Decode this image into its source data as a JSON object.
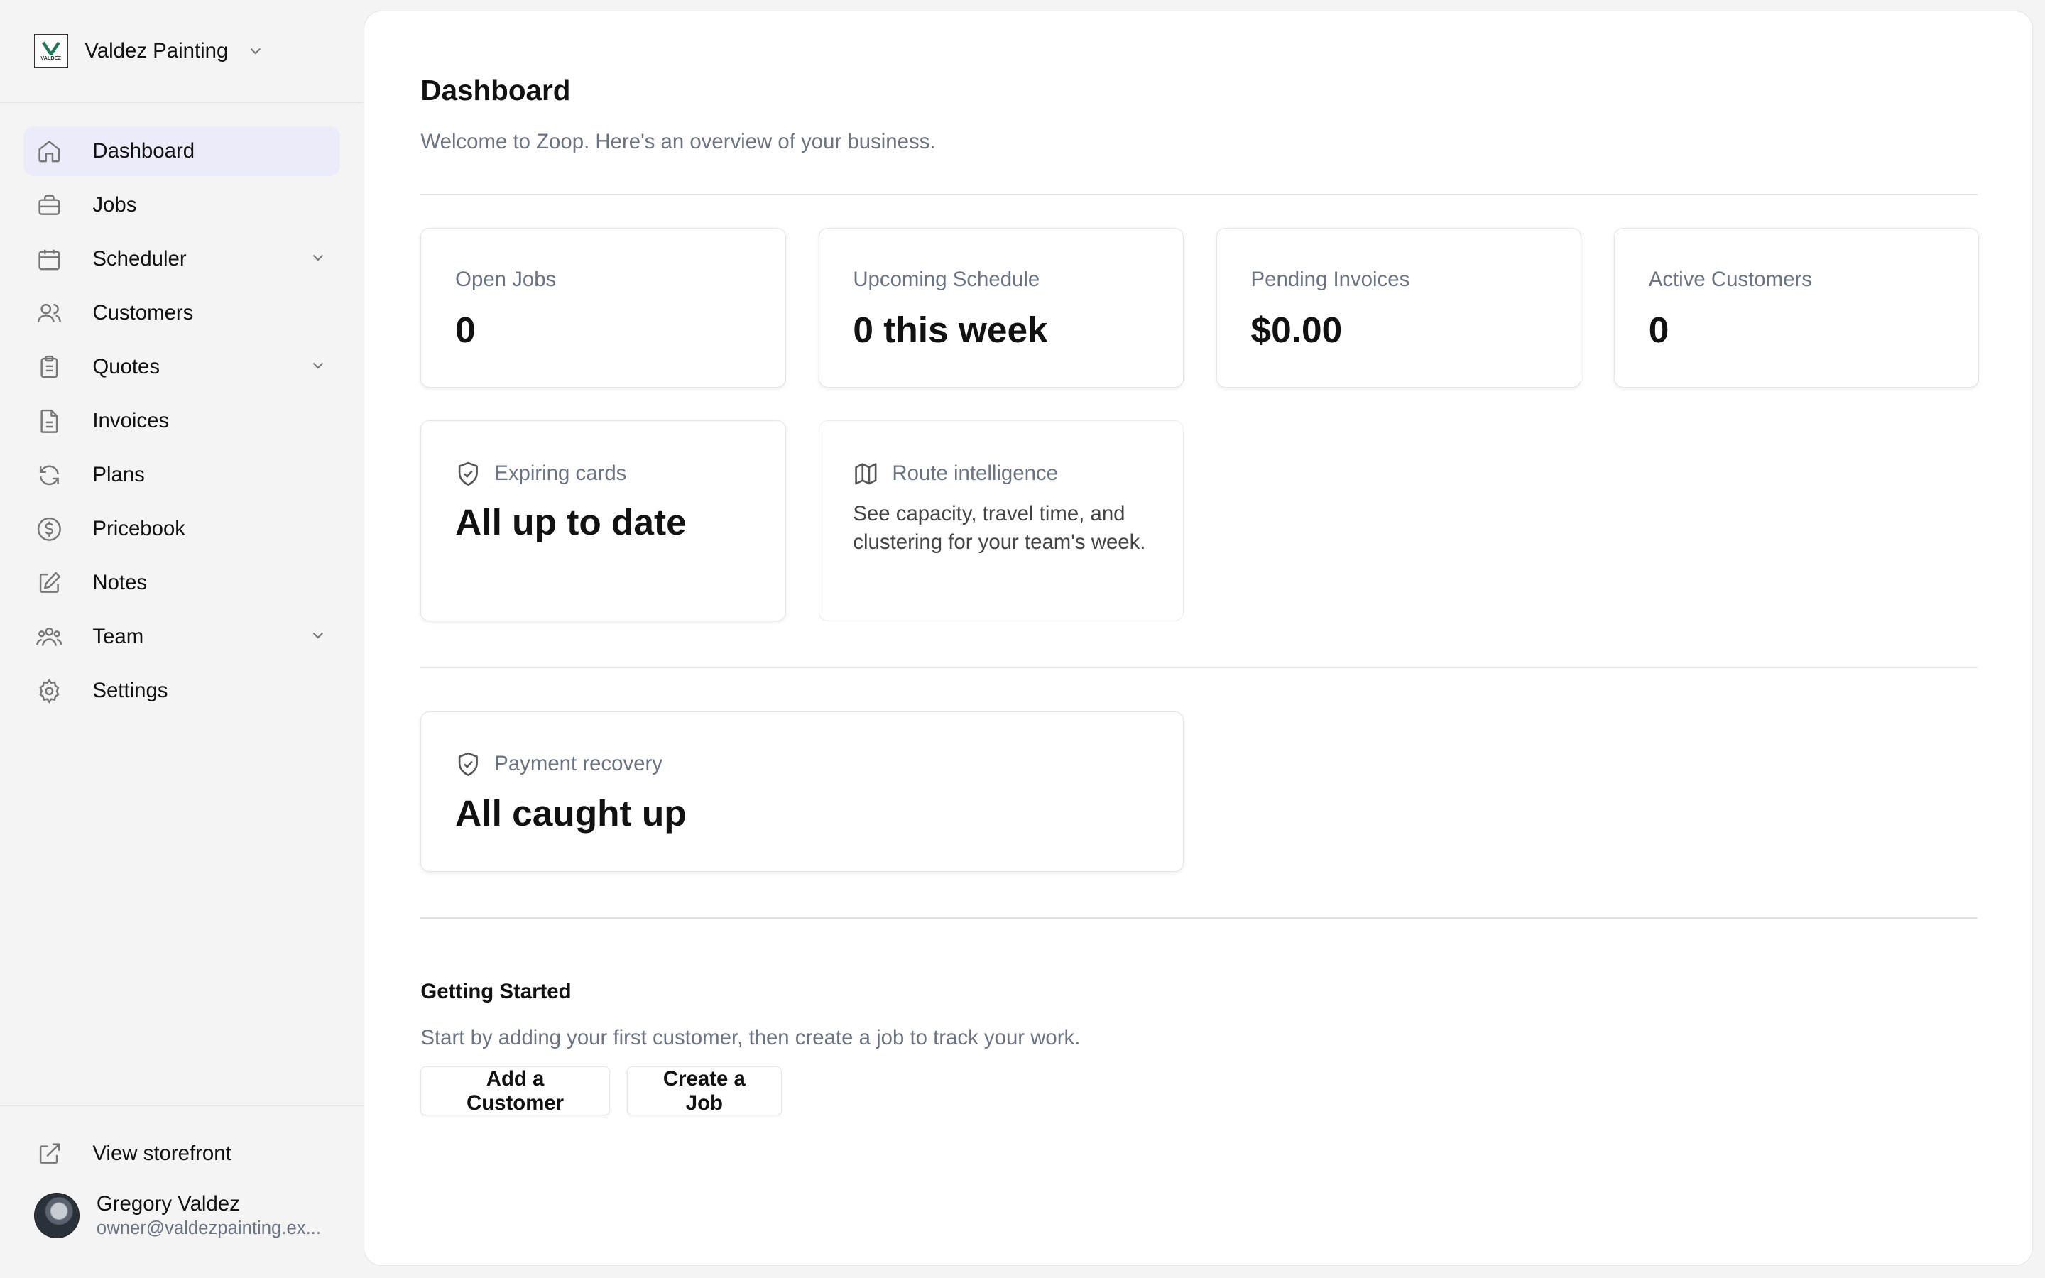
{
  "workspace": {
    "name": "Valdez Painting",
    "logo_text": "VALDEZ"
  },
  "sidebar": {
    "items": [
      {
        "label": "Dashboard",
        "icon": "home-icon",
        "active": true
      },
      {
        "label": "Jobs",
        "icon": "briefcase-icon"
      },
      {
        "label": "Scheduler",
        "icon": "calendar-icon",
        "expandable": true
      },
      {
        "label": "Customers",
        "icon": "users-icon"
      },
      {
        "label": "Quotes",
        "icon": "clipboard-icon",
        "expandable": true
      },
      {
        "label": "Invoices",
        "icon": "file-text-icon"
      },
      {
        "label": "Plans",
        "icon": "refresh-icon"
      },
      {
        "label": "Pricebook",
        "icon": "dollar-circle-icon"
      },
      {
        "label": "Notes",
        "icon": "edit-icon"
      },
      {
        "label": "Team",
        "icon": "team-icon",
        "expandable": true
      },
      {
        "label": "Settings",
        "icon": "gear-icon"
      }
    ],
    "storefront_label": "View storefront"
  },
  "user": {
    "name": "Gregory Valdez",
    "email": "owner@valdezpainting.ex..."
  },
  "main": {
    "title": "Dashboard",
    "subtitle": "Welcome to Zoop. Here's an overview of your business.",
    "stats": [
      {
        "label": "Open Jobs",
        "value": "0"
      },
      {
        "label": "Upcoming Schedule",
        "value": "0 this week"
      },
      {
        "label": "Pending Invoices",
        "value": "$0.00"
      },
      {
        "label": "Active Customers",
        "value": "0"
      }
    ],
    "expiring_cards": {
      "label": "Expiring cards",
      "value": "All up to date",
      "icon": "shield-check-icon"
    },
    "route_intelligence": {
      "label": "Route intelligence",
      "description": "See capacity, travel time, and clustering for your team's week.",
      "icon": "map-icon"
    },
    "payment_recovery": {
      "label": "Payment recovery",
      "value": "All caught up",
      "icon": "shield-check-icon"
    },
    "getting_started": {
      "title": "Getting Started",
      "description": "Start by adding your first customer, then create a job to track your work.",
      "add_customer_label": "Add a Customer",
      "create_job_label": "Create a Job"
    }
  },
  "colors": {
    "active_nav_bg": "#ebebfa",
    "muted_text": "#6b7280",
    "border": "#e4e4e7",
    "logo_green": "#1f7a5a"
  }
}
